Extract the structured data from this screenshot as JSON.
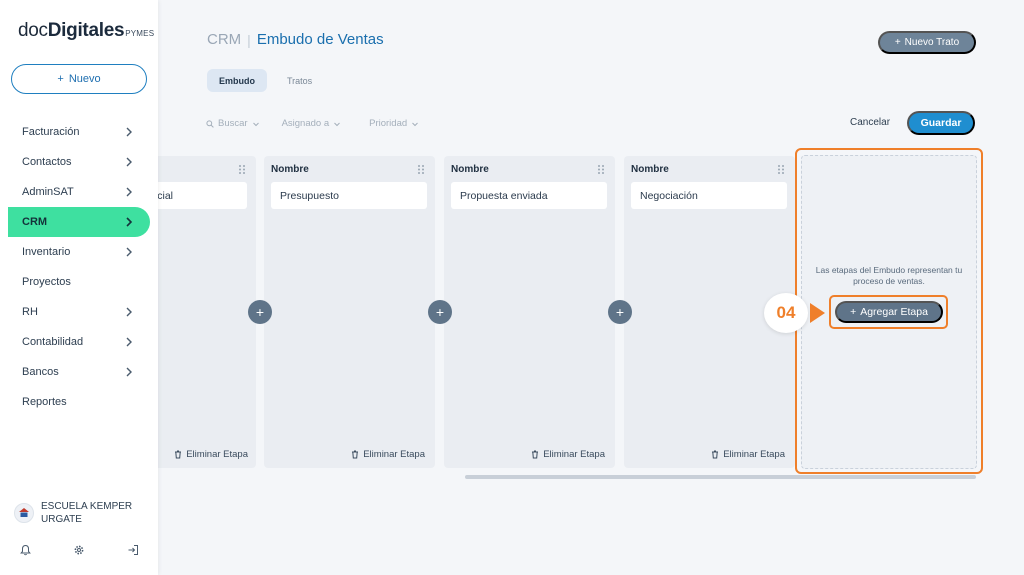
{
  "brand": {
    "light": "doc",
    "bold": "Digitales",
    "sub": "PYMES"
  },
  "sidebar": {
    "new_label": "Nuevo",
    "items": [
      {
        "label": "Facturación",
        "chevron": true
      },
      {
        "label": "Contactos",
        "chevron": true
      },
      {
        "label": "AdminSAT",
        "chevron": true
      },
      {
        "label": "CRM",
        "chevron": true,
        "active": true
      },
      {
        "label": "Inventario",
        "chevron": true
      },
      {
        "label": "Proyectos",
        "chevron": false
      },
      {
        "label": "RH",
        "chevron": true
      },
      {
        "label": "Contabilidad",
        "chevron": true
      },
      {
        "label": "Bancos",
        "chevron": true
      },
      {
        "label": "Reportes",
        "chevron": false
      }
    ],
    "user_name": "ESCUELA KEMPER URGATE",
    "footer_icons": [
      "bell-icon",
      "gear-icon",
      "logout-icon"
    ]
  },
  "header": {
    "crumb_parent": "CRM",
    "separator": "|",
    "title": "Embudo de Ventas",
    "new_deal_label": "Nuevo Trato"
  },
  "tabs": [
    {
      "label": "Embudo",
      "active": true
    },
    {
      "label": "Tratos",
      "active": false
    }
  ],
  "filters": {
    "search_label": "Buscar",
    "assigned_label": "Asignado a",
    "priority_label": "Prioridad"
  },
  "actions": {
    "cancel_label": "Cancelar",
    "save_label": "Guardar"
  },
  "board": {
    "columns": [
      {
        "title": "",
        "stage": "cial",
        "delete_label": "Eliminar Etapa"
      },
      {
        "title": "Nombre",
        "stage": "Presupuesto",
        "delete_label": "Eliminar Etapa"
      },
      {
        "title": "Nombre",
        "stage": "Propuesta enviada",
        "delete_label": "Eliminar Etapa"
      },
      {
        "title": "Nombre",
        "stage": "Negociación",
        "delete_label": "Eliminar Etapa"
      }
    ],
    "add_stage_text": "Las etapas del Embudo representan tu proceso de ventas.",
    "add_stage_label": "Agregar Etapa"
  },
  "tutorial": {
    "step": "04",
    "accent": "#ef7f2a"
  },
  "colors": {
    "active_nav": "#3ee0a0",
    "primary": "#1f8ed0",
    "slate": "#5f7489"
  }
}
